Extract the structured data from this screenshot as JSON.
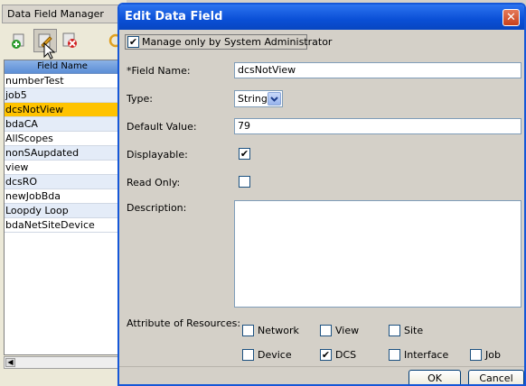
{
  "background_window": {
    "title": "Data Field Manager",
    "list_header": "Field Name",
    "rows": [
      "numberTest",
      "job5",
      "dcsNotView",
      "bdaCA",
      "AllScopes",
      "nonSAupdated",
      "view",
      "dcsRO",
      "newJobBda",
      "Loopdy Loop",
      "bdaNetSiteDevice"
    ],
    "selected_row": "dcsNotView",
    "scroll_left_glyph": "◀"
  },
  "dialog": {
    "title": "Edit Data Field",
    "close_glyph": "✕",
    "admin_checkbox_label": "Manage only by System Administrator",
    "admin_checked": true,
    "field_name_label": "*Field Name:",
    "field_name_value": "dcsNotView",
    "type_label": "Type:",
    "type_value": "String",
    "default_label": "Default Value:",
    "default_value": "79",
    "displayable_label": "Displayable:",
    "displayable_checked": true,
    "readonly_label": "Read Only:",
    "readonly_checked": false,
    "description_label": "Description:",
    "description_value": "",
    "attributes_label": "Attribute of Resources:",
    "attributes": [
      {
        "label": "Network",
        "checked": false
      },
      {
        "label": "View",
        "checked": false
      },
      {
        "label": "Site",
        "checked": false
      },
      {
        "label": "Device",
        "checked": false
      },
      {
        "label": "DCS",
        "checked": true
      },
      {
        "label": "Interface",
        "checked": false
      },
      {
        "label": "Job",
        "checked": false
      }
    ],
    "ok_label": "OK",
    "cancel_label": "Cancel",
    "check_glyph": "✔"
  },
  "colors": {
    "selection": "#ffc300",
    "title_bar": "#0a4fd6",
    "alt_row": "#e4ecf8"
  }
}
